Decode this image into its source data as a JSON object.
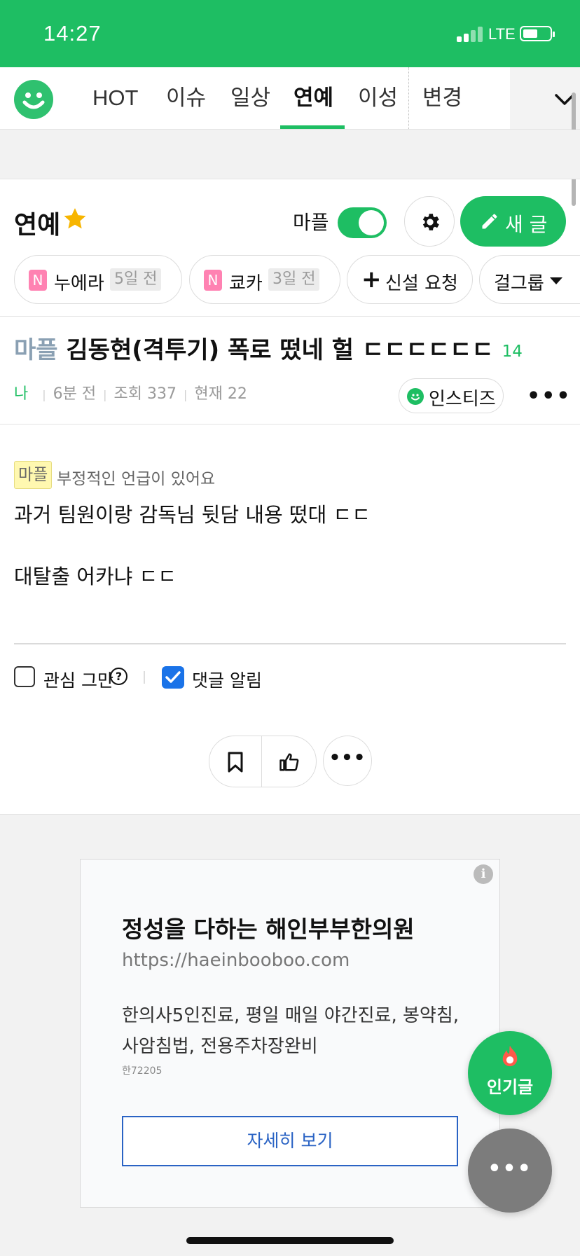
{
  "status_bar": {
    "time": "14:27",
    "network": "LTE"
  },
  "nav": {
    "tabs": [
      {
        "label": "HOT"
      },
      {
        "label": "이슈"
      },
      {
        "label": "일상"
      },
      {
        "label": "연예"
      },
      {
        "label": "이성"
      },
      {
        "label": "변경"
      }
    ],
    "active_tab": "연예"
  },
  "board": {
    "title": "연예",
    "toggle_label": "마플",
    "toggle_on": true,
    "new_post_label": "새 글"
  },
  "chips": [
    {
      "badge": "N",
      "name": "누에라",
      "age": "5일 전"
    },
    {
      "badge": "N",
      "name": "쿄카",
      "age": "3일 전"
    }
  ],
  "request_chip": {
    "label": "신설 요청"
  },
  "group_chip": {
    "label": "걸그룹"
  },
  "post": {
    "tag": "마플",
    "title": "김동현(격투기) 폭로 떴네 헐 ㄷㄷㄷㄷㄷㄷ",
    "comment_count": "14",
    "author": "나",
    "time": "6분 전",
    "views": "조회 337",
    "current": "현재 22",
    "source_label": "인스티즈",
    "notice_badge": "마플",
    "notice_text": "부정적인 언급이 있어요",
    "body_lines": [
      "과거 팀원이랑 감독님 뒷담 내용 떴대 ㄷㄷ",
      "대탈출 어카냐 ㄷㄷ"
    ]
  },
  "options": {
    "stop_interest": "관심 그만",
    "comment_alert": "댓글 알림",
    "comment_alert_checked": true
  },
  "ad": {
    "title": "정성을 다하는 해인부부한의원",
    "url": "https://haeinbooboo.com",
    "description": "한의사5인진료, 평일 매일 야간진료, 봉약침, 사암침법, 전용주차장완비",
    "code": "한72205",
    "cta": "자세히 보기"
  },
  "fab": {
    "popular_label": "인기글"
  },
  "colors": {
    "brand": "#1ebe63",
    "link_blue": "#2a63c4",
    "checkbox_blue": "#1a73e8"
  }
}
